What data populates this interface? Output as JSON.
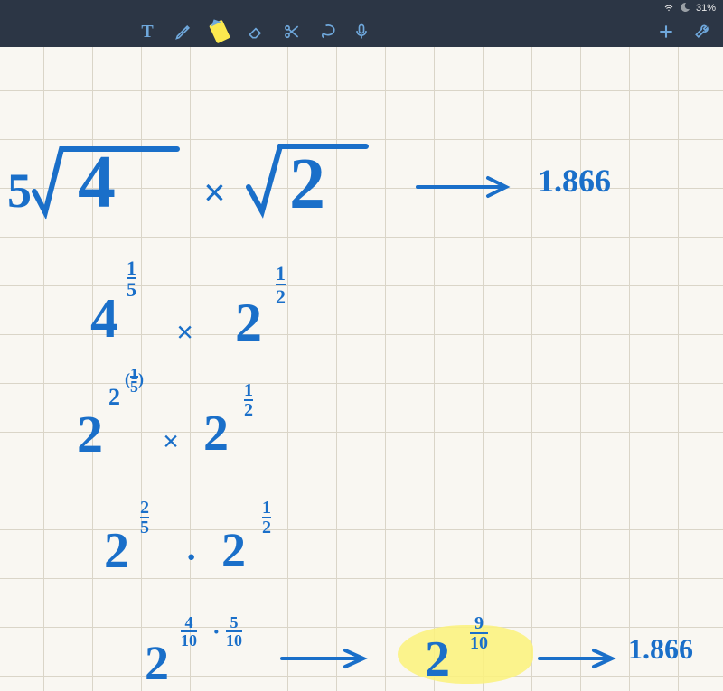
{
  "status": {
    "battery": "31%",
    "wifi_icon": "wifi",
    "moon_icon": "dnd"
  },
  "toolbar": {
    "text_tool": "T",
    "tools": [
      "text",
      "pen",
      "highlighter",
      "eraser",
      "scissors",
      "lasso"
    ],
    "center": "microphone",
    "right": [
      "add",
      "wrench"
    ]
  },
  "notes": {
    "line1_root5_4": "⁵√4",
    "line1_times": "×",
    "line1_root2": "√2",
    "line1_arrow": "→",
    "line1_result": "1.866",
    "line2_4": "4",
    "line2_exp_1_5": "1/5",
    "line2_times": "×",
    "line2_2": "2",
    "line2_exp_1_2": "1/2",
    "line3_2": "2",
    "line3_exp_2_15": "2(1/5)",
    "line3_times": "×",
    "line3_2b": "2",
    "line3_exp_1_2": "1/2",
    "line4_2": "2",
    "line4_exp_2_5": "2/5",
    "line4_dot": "·",
    "line4_2b": "2",
    "line4_exp_1_2": "1/2",
    "line5_2": "2",
    "line5_exp_4_10": "4/10",
    "line5_dot": "·",
    "line5_exp_5_10": "5/10",
    "line5_arrow": "→",
    "line5_2hl": "2",
    "line5_exp_9_10": "9/10",
    "line5_arrow2": "→",
    "line5_result": "1.866"
  }
}
